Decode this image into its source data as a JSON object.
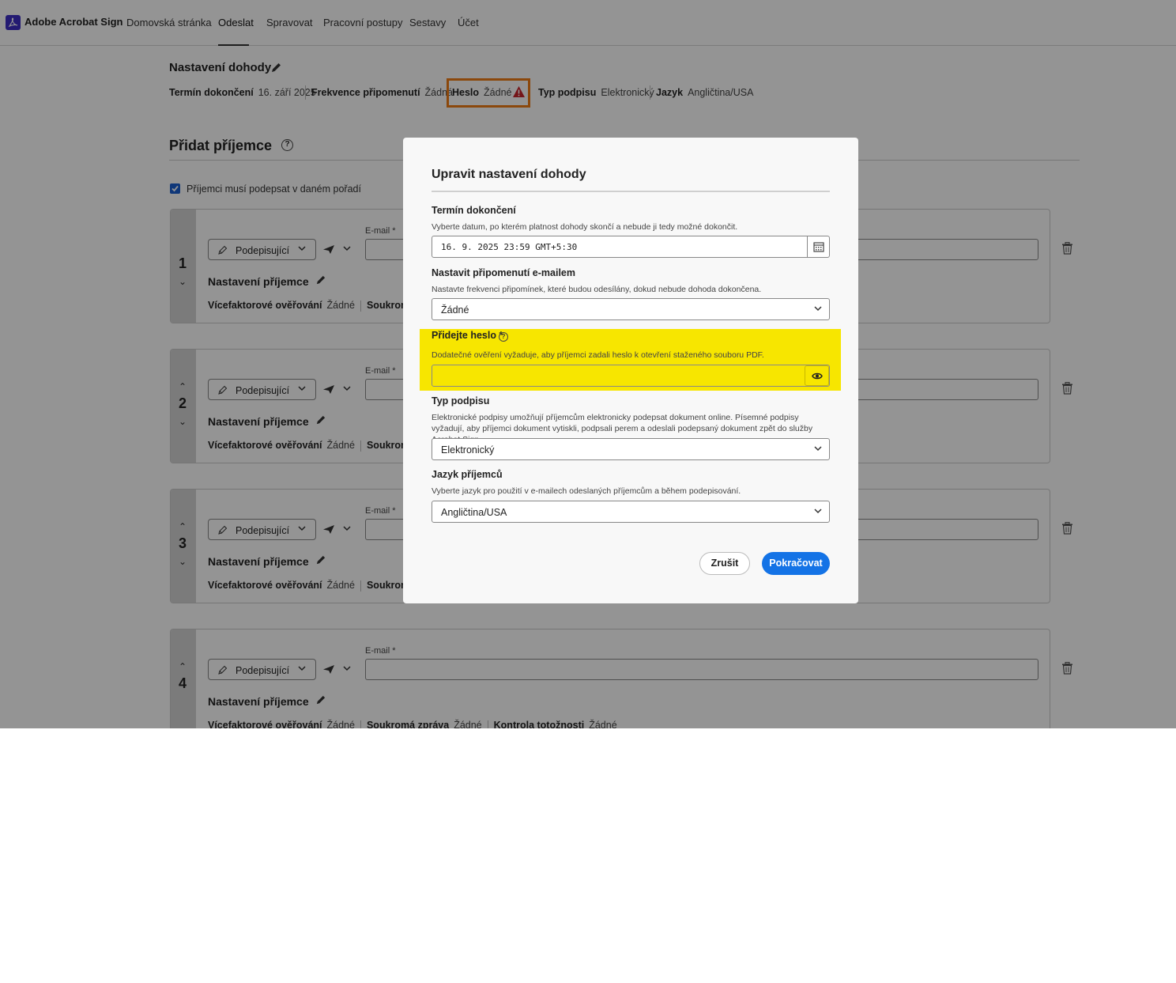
{
  "nav": {
    "brand": "Adobe Acrobat Sign",
    "links": [
      "Domovská stránka",
      "Odeslat",
      "Spravovat",
      "Pracovní postupy",
      "Sestavy",
      "Účet"
    ]
  },
  "agreement": {
    "title": "Nastavení dohody",
    "deadline_label": "Termín dokončení",
    "deadline_value": "16. září 2025",
    "reminder_label": "Frekvence připomenutí",
    "reminder_value": "Žádná",
    "password_label": "Heslo",
    "password_value": "Žádné",
    "sigtype_label": "Typ podpisu",
    "sigtype_value": "Elektronický",
    "lang_label": "Jazyk",
    "lang_value": "Angličtina/USA"
  },
  "recipients": {
    "title": "Přidat příjemce",
    "order_label": "Příjemci musí podepsat v daném pořadí",
    "role": "Podepisující",
    "email_label": "E-mail *",
    "settings_title": "Nastavení příjemce",
    "mfa_label": "Vícefaktorové ověřování",
    "mfa_value": "Žádné",
    "msg_label": "Soukromá zpráva",
    "msg_value": "Žádné",
    "id_label": "Kontrola totožnosti",
    "id_value": "Žádné",
    "cards": [
      {
        "num": "1"
      },
      {
        "num": "2"
      },
      {
        "num": "3"
      },
      {
        "num": "4"
      }
    ]
  },
  "modal": {
    "title": "Upravit nastavení dohody",
    "deadline_label": "Termín dokončení",
    "deadline_desc": "Vyberte datum, po kterém platnost dohody skončí a nebude ji tedy možné dokončit.",
    "deadline_value": "16. 9. 2025 23:59 GMT+5:30",
    "reminder_label": "Nastavit připomenutí e-mailem",
    "reminder_desc": "Nastavte frekvenci připomínek, které budou odesílány, dokud nebude dohoda dokončena.",
    "reminder_value": "Žádné",
    "password_label": "Přidejte heslo *",
    "password_desc": "Dodatečné ověření vyžaduje, aby příjemci zadali heslo k otevření staženého souboru PDF.",
    "password_value": "",
    "sigtype_label": "Typ podpisu",
    "sigtype_desc": "Elektronické podpisy umožňují příjemcům elektronicky podepsat dokument online. Písemné podpisy vyžadují, aby příjemci dokument vytiskli, podpsali perem a odeslali podepsaný dokument zpět do služby Acrobat Sign.",
    "sigtype_value": "Elektronický",
    "lang_label": "Jazyk příjemců",
    "lang_desc": "Vyberte jazyk pro použití v e-mailech odeslaných příjemcům a během podepisování.",
    "lang_value": "Angličtina/USA",
    "cancel_label": "Zrušit",
    "continue_label": "Pokračovat"
  },
  "colors": {
    "accent": "#1473e6",
    "highlight_yellow": "#f7e600",
    "highlight_orange": "#f07c15",
    "warning": "#c9252c"
  }
}
